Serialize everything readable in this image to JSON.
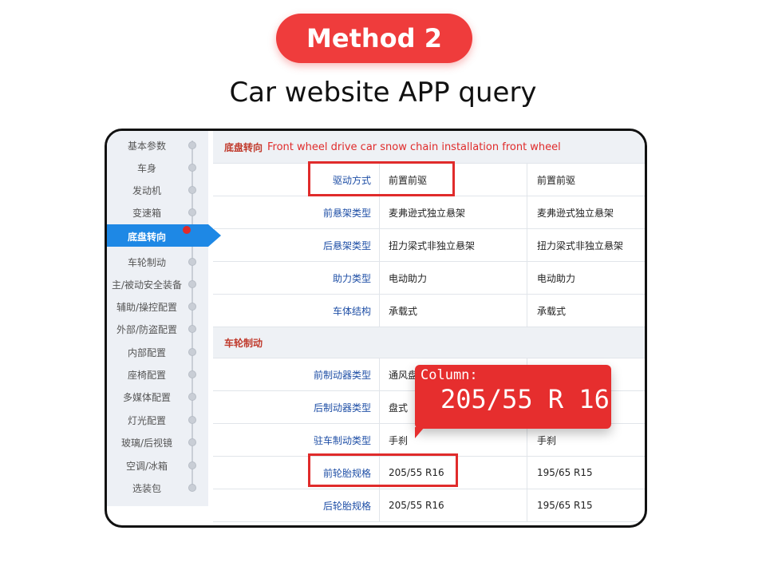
{
  "header": {
    "method_label": "Method 2",
    "subtitle": "Car website APP query"
  },
  "sidebar": {
    "items": [
      "基本参数",
      "车身",
      "发动机",
      "变速箱",
      "底盘转向",
      "车轮制动",
      "主/被动安全装备",
      "辅助/操控配置",
      "外部/防盗配置",
      "内部配置",
      "座椅配置",
      "多媒体配置",
      "灯光配置",
      "玻璃/后视镜",
      "空调/冰箱",
      "选装包"
    ],
    "active_index": 4
  },
  "section1": {
    "title": "底盘转向",
    "note": "Front wheel drive car snow chain installation front wheel"
  },
  "rows1": [
    {
      "label": "驱动方式",
      "v1": "前置前驱",
      "v2": "前置前驱"
    },
    {
      "label": "前悬架类型",
      "v1": "麦弗逊式独立悬架",
      "v2": "麦弗逊式独立悬架"
    },
    {
      "label": "后悬架类型",
      "v1": "扭力梁式非独立悬架",
      "v2": "扭力梁式非独立悬架"
    },
    {
      "label": "助力类型",
      "v1": "电动助力",
      "v2": "电动助力"
    },
    {
      "label": "车体结构",
      "v1": "承载式",
      "v2": "承载式"
    }
  ],
  "section2": {
    "title": "车轮制动"
  },
  "rows2": [
    {
      "label": "前制动器类型",
      "v1": "通风盘",
      "v2": ""
    },
    {
      "label": "后制动器类型",
      "v1": "盘式",
      "v2": ""
    },
    {
      "label": "驻车制动类型",
      "v1": "手刹",
      "v2": "手刹"
    },
    {
      "label": "前轮胎规格",
      "v1": "205/55 R16",
      "v2": "195/65 R15"
    },
    {
      "label": "后轮胎规格",
      "v1": "205/55 R16",
      "v2": "195/65 R15"
    }
  ],
  "callout": {
    "label": "Column:",
    "value": "205/55 R 16"
  },
  "colors": {
    "accent": "#ef3c3c",
    "active_blue": "#1e88e5",
    "label_blue": "#1f4fa6",
    "section_red": "#c0392b"
  }
}
